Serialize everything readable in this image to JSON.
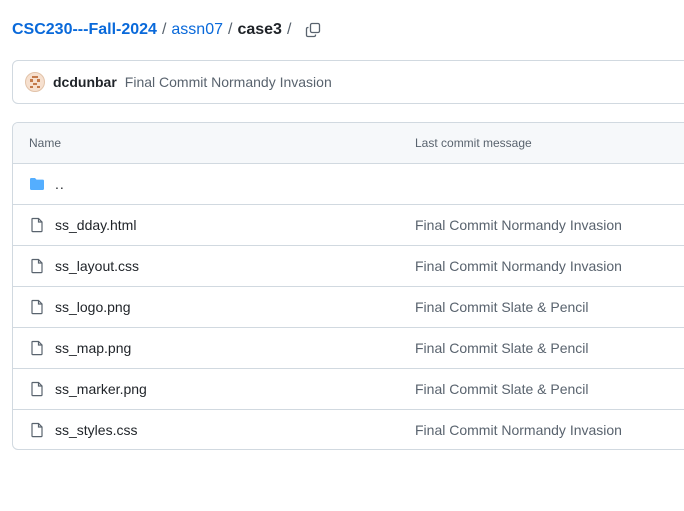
{
  "breadcrumb": {
    "repo": "CSC230---Fall-2024",
    "folder": "assn07",
    "current": "case3",
    "separator": "/"
  },
  "commit": {
    "author": "dcdunbar",
    "message": "Final Commit Normandy Invasion"
  },
  "table": {
    "headers": {
      "name": "Name",
      "message": "Last commit message"
    },
    "parent": {
      "name": "..",
      "icon": "folder-icon"
    },
    "files": [
      {
        "name": "ss_dday.html",
        "message": "Final Commit Normandy Invasion",
        "icon": "file-icon"
      },
      {
        "name": "ss_layout.css",
        "message": "Final Commit Normandy Invasion",
        "icon": "file-icon"
      },
      {
        "name": "ss_logo.png",
        "message": "Final Commit Slate & Pencil",
        "icon": "file-icon"
      },
      {
        "name": "ss_map.png",
        "message": "Final Commit Slate & Pencil",
        "icon": "file-icon"
      },
      {
        "name": "ss_marker.png",
        "message": "Final Commit Slate & Pencil",
        "icon": "file-icon"
      },
      {
        "name": "ss_styles.css",
        "message": "Final Commit Normandy Invasion",
        "icon": "file-icon"
      }
    ]
  },
  "colors": {
    "link": "#0969da",
    "text": "#1f2328",
    "muted": "#59636e",
    "border": "#d1d9e0",
    "header_bg": "#f6f8fa",
    "folder": "#54aeff"
  }
}
